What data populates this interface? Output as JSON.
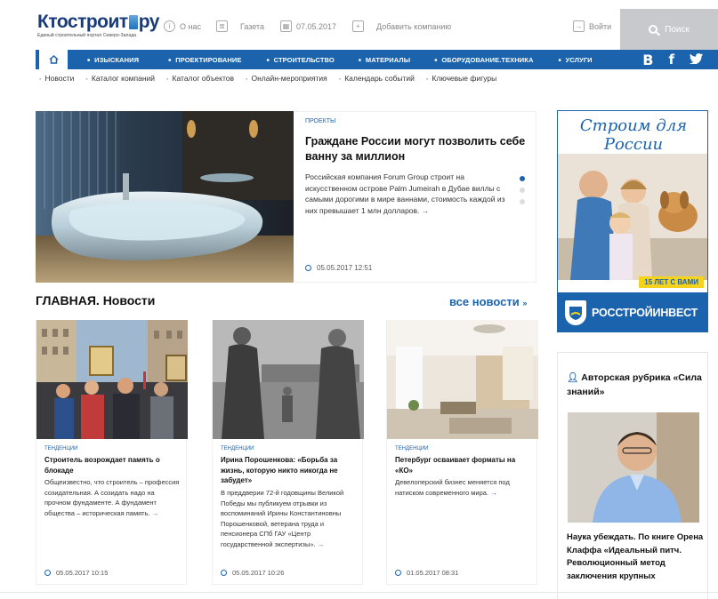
{
  "logo": {
    "text_a": "Кто",
    "text_b": "строит",
    "text_c": "ру",
    "subtitle": "Единый строительный портал Северо-Запада"
  },
  "topnav": {
    "about": "О нас",
    "newspaper": "Газета",
    "date": "07.05.2017",
    "add_company": "Добавить компанию",
    "login": "Войти",
    "search": "Поиск"
  },
  "mainnav": {
    "items": [
      "ИЗЫСКАНИЯ",
      "ПРОЕКТИРОВАНИЕ",
      "СТРОИТЕЛЬСТВО",
      "МАТЕРИАЛЫ",
      "ОБОРУДОВАНИЕ.ТЕХНИКА",
      "УСЛУГИ"
    ],
    "social": [
      "B",
      "f",
      "t"
    ]
  },
  "subnav": [
    "Новости",
    "Каталог компаний",
    "Каталог объектов",
    "Онлайн-мероприятия",
    "Календарь событий",
    "Ключевые фигуры"
  ],
  "featured": {
    "category": "ПРОЕКТЫ",
    "title": "Граждане России могут позволить себе ванну за миллион",
    "desc": "Российская компания Forum Group строит на искусственном острове Palm Jumeirah в Дубае виллы с самыми дорогими в мире ваннами, стоимость каждой из них превышает 1 млн долларов.",
    "date": "05.05.2017 12:51"
  },
  "section": {
    "title": "ГЛАВНАЯ. Новости",
    "all_news": "все новости",
    "all_news_arrow": "»"
  },
  "cards": [
    {
      "category": "ТЕНДЕНЦИИ",
      "title": "Строитель возрождает память о блокаде",
      "desc": "Общеизвестно, что строитель – профессия созидательная. А созидать надо на прочном фундаменте. А фундамент общества – историческая память.",
      "date": "05.05.2017 10:15"
    },
    {
      "category": "ТЕНДЕНЦИИ",
      "title": "Ирина Порошенкова: «Борьба за жизнь, которую никто никогда не забудет»",
      "desc": "В преддверии 72-й годовщины Великой Победы мы публикуем отрывки из воспоминаний Ирины Константиновны Порошенковой, ветерана труда и пенсионера СПб ГАУ «Центр государственной экспертизы».",
      "date": "05.05.2017 10:26"
    },
    {
      "category": "ТЕНДЕНЦИИ",
      "title": "Петербург осваивает форматы на «КО»",
      "desc": "Девелоперский бизнес меняется под натиском современного мира.",
      "date": "01.05.2017 08:31"
    }
  ],
  "ad": {
    "script": "Строим для России",
    "badge": "15 ЛЕТ С ВАМИ",
    "brand": "РОССТРОЙИНВЕСТ"
  },
  "author": {
    "heading": "Авторская рубрика «Сила знаний»",
    "text": "Наука убеждать. По книге Орена Клаффа «Идеальный питч. Революционный метод заключения крупных"
  },
  "colors": {
    "accent": "#1b63ad",
    "ad_yellow": "#f4d21e"
  },
  "icons": [
    "info-icon",
    "newspaper-icon",
    "calendar-icon",
    "add-icon",
    "login-icon",
    "search-icon",
    "home-icon",
    "clock-icon",
    "user-icon"
  ]
}
